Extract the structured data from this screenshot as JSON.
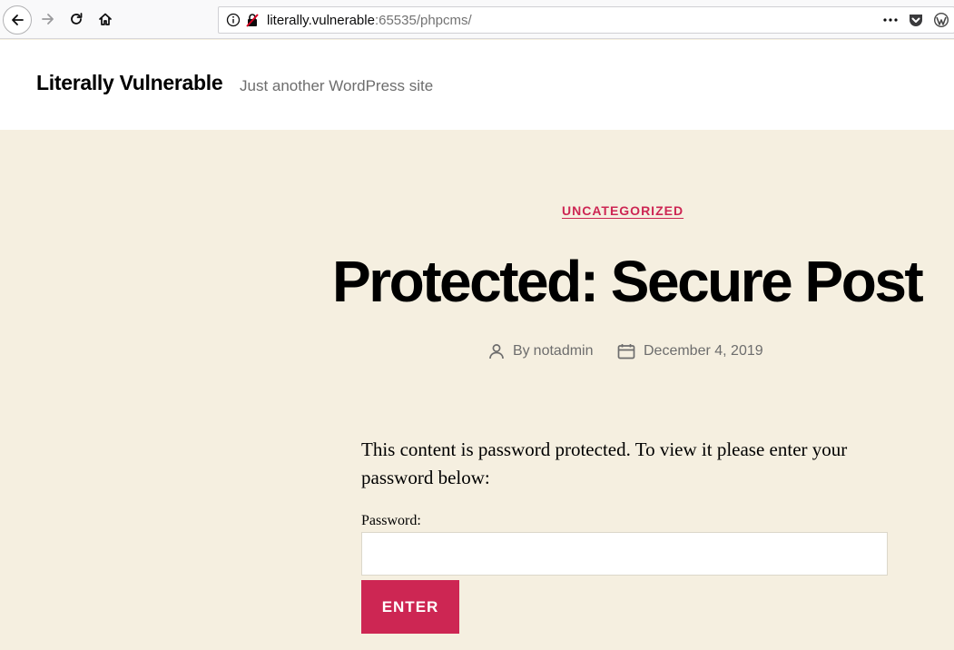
{
  "browser": {
    "url_host": "literally.vulnerable",
    "url_rest": ":65535/phpcms/",
    "icons": [
      "back-icon",
      "forward-icon",
      "reload-icon",
      "home-icon",
      "info-icon",
      "insecure-lock-icon",
      "more-icon",
      "pocket-icon",
      "wordpress-icon"
    ]
  },
  "site": {
    "title": "Literally Vulnerable",
    "tagline": "Just another WordPress site"
  },
  "post": {
    "category": "UNCATEGORIZED",
    "title": "Protected: Secure Post",
    "author_prefix": "By",
    "author": "notadmin",
    "date": "December 4, 2019",
    "protected_message": "This content is password protected. To view it please enter your password below:",
    "password_label": "Password:",
    "password_value": "",
    "submit_label": "ENTER"
  },
  "colors": {
    "accent": "#cd2653",
    "background": "#f5efe0",
    "header_background": "#ffffff",
    "meta_text": "#6d6d6d"
  }
}
